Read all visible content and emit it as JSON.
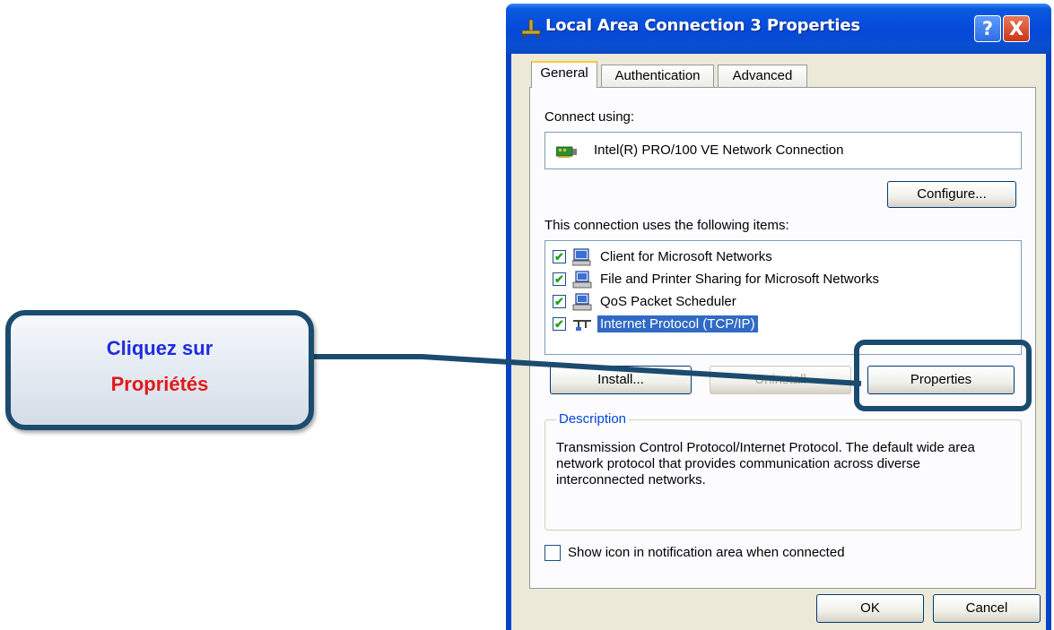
{
  "window": {
    "title": "Local Area Connection 3 Properties",
    "help_button": "?",
    "close_button": "X"
  },
  "tabs": [
    {
      "label": "General",
      "active": true
    },
    {
      "label": "Authentication",
      "active": false
    },
    {
      "label": "Advanced",
      "active": false
    }
  ],
  "general": {
    "connect_using_label": "Connect using:",
    "adapter_name": "Intel(R) PRO/100 VE Network Connection",
    "configure_button": "Configure...",
    "items_label": "This connection uses the following items:",
    "items": [
      {
        "label": "Client for Microsoft Networks",
        "checked": true,
        "selected": false,
        "icon": "network-client-icon"
      },
      {
        "label": "File and Printer Sharing for Microsoft Networks",
        "checked": true,
        "selected": false,
        "icon": "network-service-icon"
      },
      {
        "label": "QoS Packet Scheduler",
        "checked": true,
        "selected": false,
        "icon": "network-service-icon"
      },
      {
        "label": "Internet Protocol (TCP/IP)",
        "checked": true,
        "selected": true,
        "icon": "network-protocol-icon"
      }
    ],
    "install_button": "Install...",
    "uninstall_button": "Uninstall",
    "properties_button": "Properties",
    "description_legend": "Description",
    "description_text": "Transmission Control Protocol/Internet Protocol. The default wide area network protocol that provides communication across diverse interconnected networks.",
    "show_icon_label": "Show icon in notification area when connected",
    "show_icon_checked": false
  },
  "footer": {
    "ok_button": "OK",
    "cancel_button": "Cancel"
  },
  "callout": {
    "line1": "Cliquez sur",
    "line2": "Propriétés",
    "line1_color": "#1e2be0",
    "line2_color": "#e21818",
    "border_color": "#1b4b6e"
  }
}
